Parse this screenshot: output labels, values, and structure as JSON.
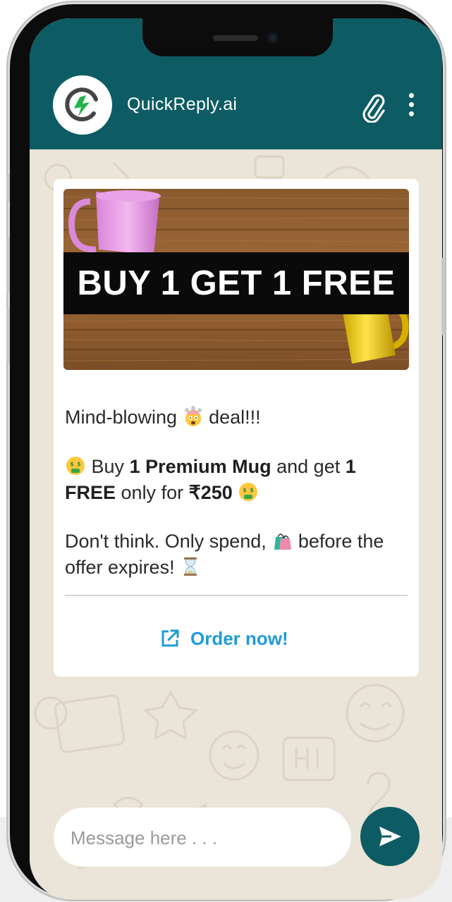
{
  "header": {
    "title": "QuickReply.ai",
    "avatar_icon": "bolt-logo-icon",
    "attach_icon": "paperclip-icon",
    "menu_icon": "more-vertical-icon"
  },
  "message": {
    "banner_text": "BUY 1 GET 1 FREE",
    "line1_pre": "Mind-blowing",
    "line1_post": "deal!!!",
    "line2_buy": "Buy",
    "line2_b1": "1 Premium Mug",
    "line2_mid": "and get",
    "line2_b2": "1 FREE",
    "line2_only": "only for",
    "line2_price": "₹250",
    "line3_pre": "Don't think. Only spend,",
    "line3_post": "before the offer expires!",
    "cta_label": "Order now!",
    "cta_icon": "external-link-icon"
  },
  "composer": {
    "placeholder": "Message here . . .",
    "send_icon": "send-icon"
  },
  "colors": {
    "header": "#0d5c63",
    "send_button": "#0d5c63",
    "cta": "#1f9bd7",
    "wallpaper": "#ebe4d8"
  }
}
